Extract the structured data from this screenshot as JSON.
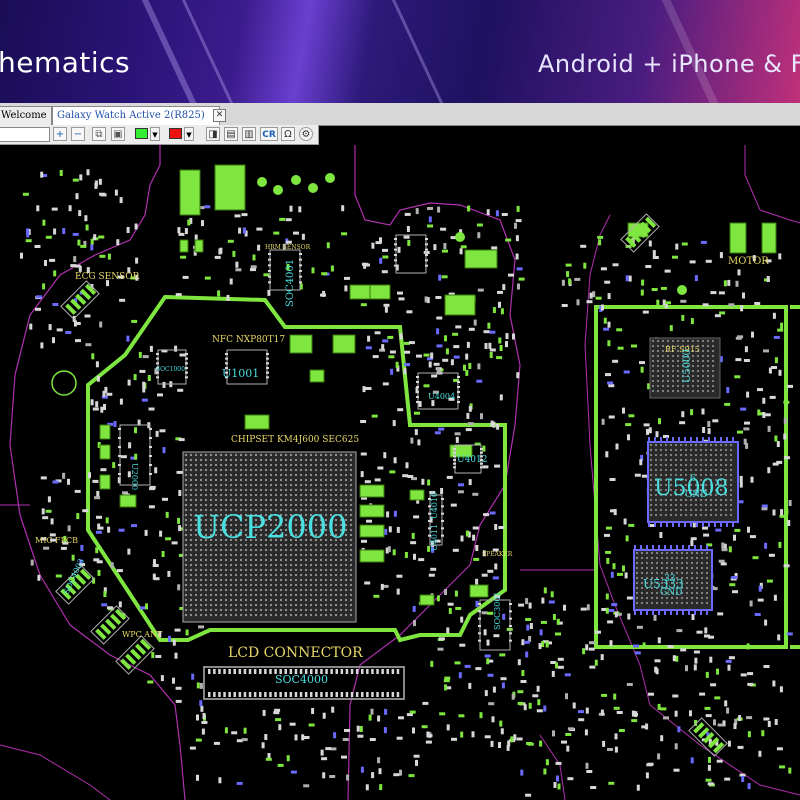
{
  "banner": {
    "title_left": "hematics",
    "title_right": "Android + iPhone & F"
  },
  "tabs": [
    {
      "label": "Welcome",
      "active": false
    },
    {
      "label": "Galaxy Watch Active 2(R825)",
      "active": true
    }
  ],
  "tab_close_glyph": "✕",
  "toolbar": {
    "zoom_in": "+",
    "zoom_out": "−",
    "cr_label": "CR",
    "omega_label": "Ω",
    "color1": "#33ee33",
    "color2": "#ee1111"
  },
  "board": {
    "board_outline_color": "#b030b0",
    "trace_color": "#7fe640",
    "labels": {
      "ecg_sensor": "ECG SENSOR",
      "hrm_sensor": "HRM SENSOR",
      "soc4001": "SOC4001",
      "soc1000": "SOC1000",
      "nfc": "NFC NXP80T17",
      "u1001": "U1001",
      "u4004": "U4004",
      "chipset": "CHIPSET KM4J600 SEC625",
      "u2000": "U2000",
      "ucp2000": "UCP2000",
      "u4012": "U4012",
      "u4010": "U4010",
      "u4011": "U4011",
      "mic_fpcb": "MIC FPCB",
      "soc4003": "SOC4003",
      "wpc_ant": "WPC ANT",
      "lcd_connector": "LCD CONNECTOR",
      "soc4000": "SOC4000",
      "speaker": "SPEAKER",
      "soc3001": "SOC3001",
      "motor": "MOTOR",
      "rf_s915": "RF S915",
      "u5000": "U5000",
      "u5008": "U5008",
      "gnd1": "GND",
      "num_6": "6",
      "num_33": "33",
      "gnd2": "GND",
      "u5333": "U5333"
    }
  }
}
